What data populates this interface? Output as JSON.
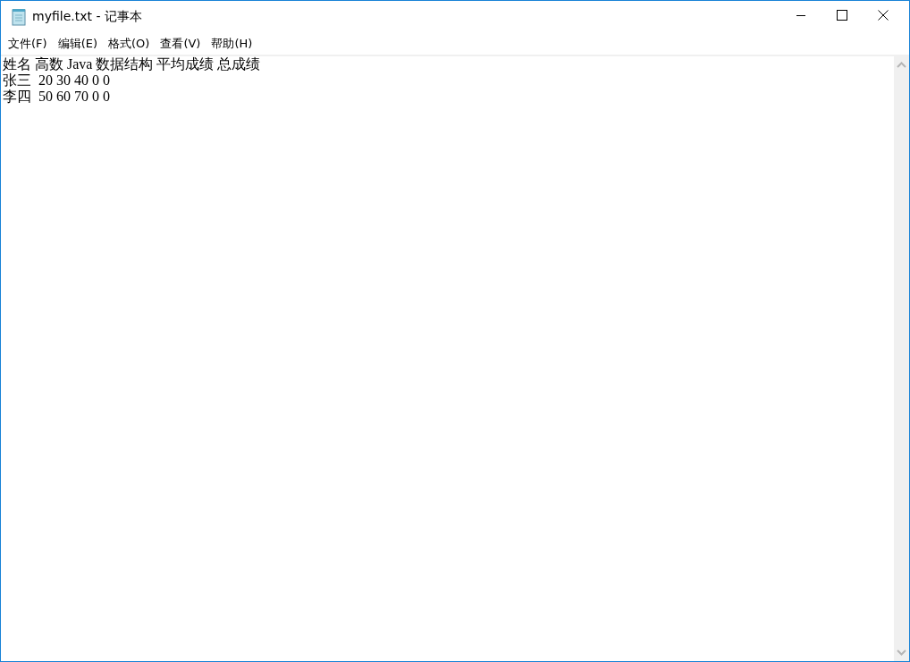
{
  "window": {
    "title": "myfile.txt - 记事本"
  },
  "menu": [
    {
      "label": "文件(F)"
    },
    {
      "label": "编辑(E)"
    },
    {
      "label": "格式(O)"
    },
    {
      "label": "查看(V)"
    },
    {
      "label": "帮助(H)"
    }
  ],
  "editor": {
    "lines": [
      "姓名 高数 Java 数据结构 平均成绩 总成绩",
      "张三  20 30 40 0 0",
      "李四  50 60 70 0 0"
    ]
  }
}
